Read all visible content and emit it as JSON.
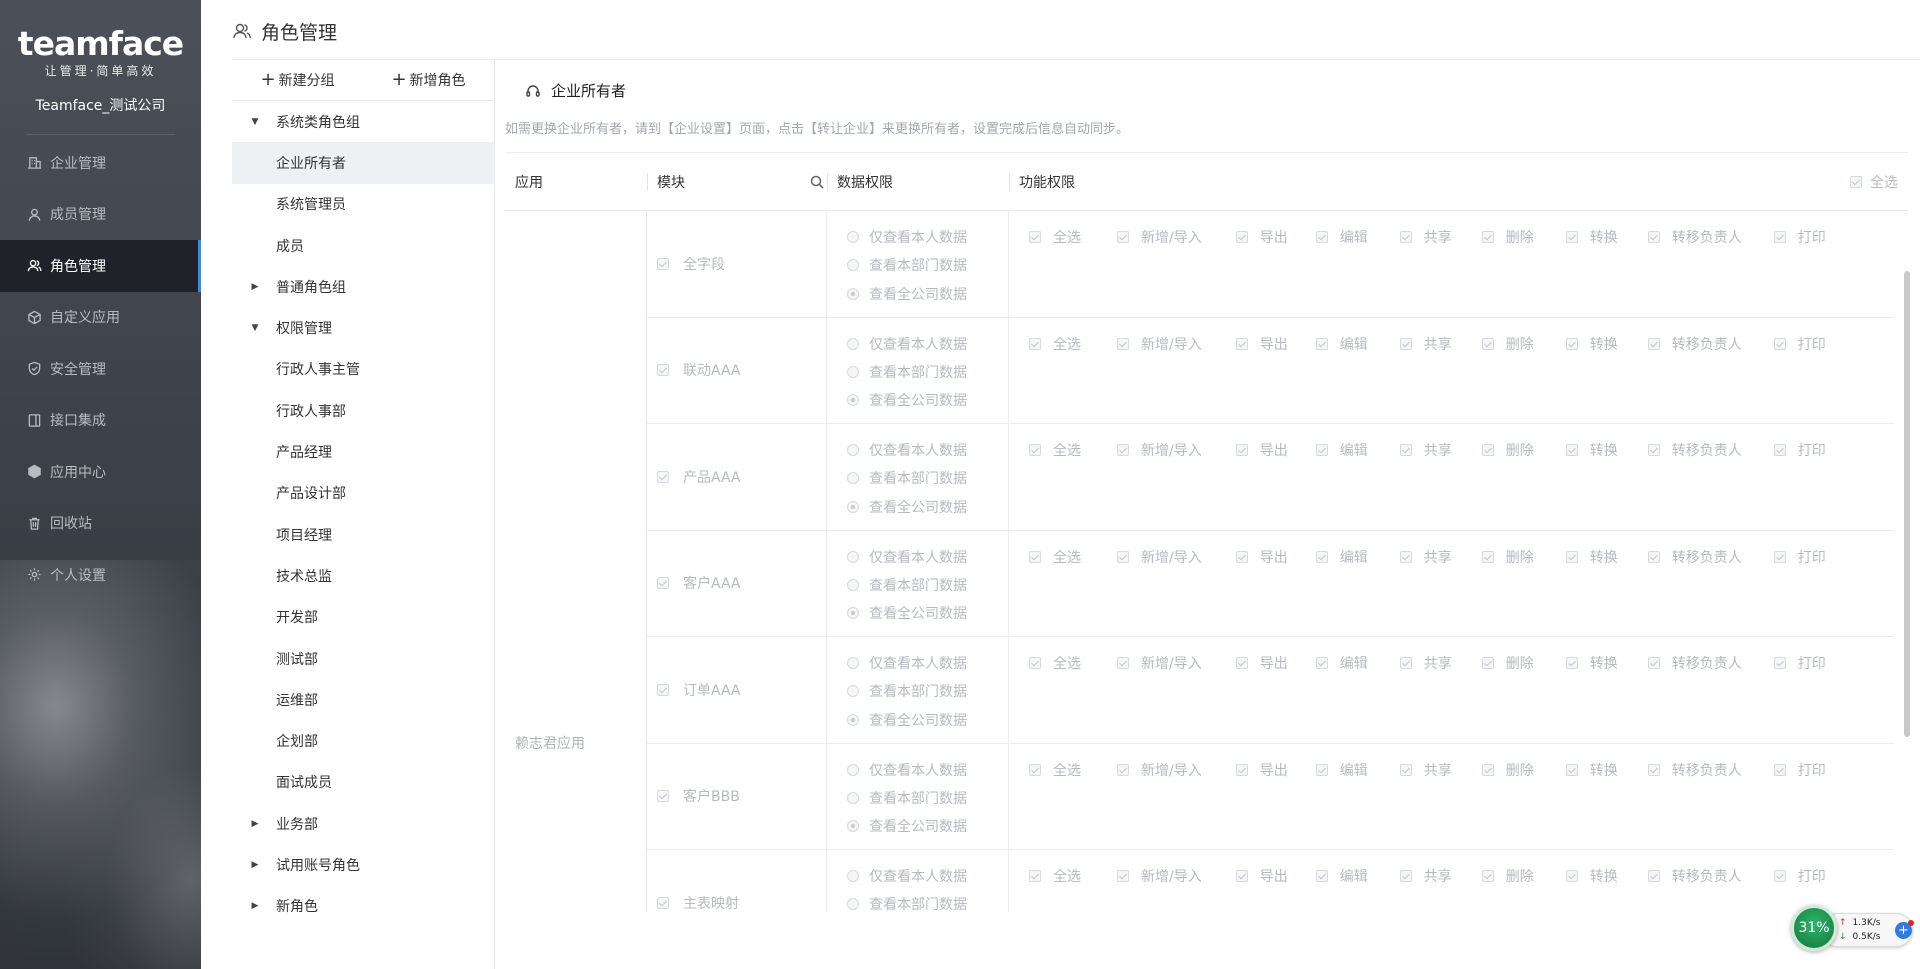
{
  "sidebar": {
    "logo": "teamface",
    "tagline": "让管理·简单高效",
    "company": "Teamface_测试公司",
    "items": [
      {
        "label": "企业管理",
        "icon": "building-icon"
      },
      {
        "label": "成员管理",
        "icon": "user-icon"
      },
      {
        "label": "角色管理",
        "icon": "users-icon",
        "active": true
      },
      {
        "label": "自定义应用",
        "icon": "cube-icon"
      },
      {
        "label": "安全管理",
        "icon": "shield-icon"
      },
      {
        "label": "接口集成",
        "icon": "plug-icon"
      },
      {
        "label": "应用中心",
        "icon": "box-icon"
      },
      {
        "label": "回收站",
        "icon": "trash-icon"
      },
      {
        "label": "个人设置",
        "icon": "gear-icon"
      }
    ]
  },
  "header": {
    "title": "角色管理",
    "icon": "users-icon"
  },
  "role_panel": {
    "new_group": "新建分组",
    "new_role": "新增角色",
    "tree": [
      {
        "label": "系统类角色组",
        "type": "group",
        "expanded": true
      },
      {
        "label": "企业所有者",
        "type": "child",
        "selected": true
      },
      {
        "label": "系统管理员",
        "type": "child"
      },
      {
        "label": "成员",
        "type": "child"
      },
      {
        "label": "普通角色组",
        "type": "group",
        "expanded": false
      },
      {
        "label": "权限管理",
        "type": "group",
        "expanded": true
      },
      {
        "label": "行政人事主管",
        "type": "child"
      },
      {
        "label": "行政人事部",
        "type": "child"
      },
      {
        "label": "产品经理",
        "type": "child"
      },
      {
        "label": "产品设计部",
        "type": "child"
      },
      {
        "label": "项目经理",
        "type": "child"
      },
      {
        "label": "技术总监",
        "type": "child"
      },
      {
        "label": "开发部",
        "type": "child"
      },
      {
        "label": "测试部",
        "type": "child"
      },
      {
        "label": "运维部",
        "type": "child"
      },
      {
        "label": "企划部",
        "type": "child"
      },
      {
        "label": "面试成员",
        "type": "child"
      },
      {
        "label": "业务部",
        "type": "group",
        "expanded": false
      },
      {
        "label": "试用账号角色",
        "type": "group",
        "expanded": false
      },
      {
        "label": "新角色",
        "type": "group",
        "expanded": false
      }
    ]
  },
  "content": {
    "title": "企业所有者",
    "title_icon": "headset-icon",
    "hint": "如需更换企业所有者，请到【企业设置】页面，点击【转让企业】来更换所有者，设置完成后信息自动同步。",
    "columns": {
      "app": "应用",
      "module": "模块",
      "data_perm": "数据权限",
      "func_perm": "功能权限",
      "select_all": "全选"
    },
    "app_name": "赖志君应用",
    "data_options": [
      "仅查看本人数据",
      "查看本部门数据",
      "查看全公司数据"
    ],
    "func_options": [
      "全选",
      "新增/导入",
      "导出",
      "编辑",
      "共享",
      "删除",
      "转换",
      "转移负责人",
      "打印"
    ],
    "modules": [
      {
        "name": "全字段",
        "selected_data": 2
      },
      {
        "name": "联动AAA",
        "selected_data": 2
      },
      {
        "name": "产品AAA",
        "selected_data": 2
      },
      {
        "name": "客户AAA",
        "selected_data": 2
      },
      {
        "name": "订单AAA",
        "selected_data": 2
      },
      {
        "name": "客户BBB",
        "selected_data": 2
      },
      {
        "name": "主表映射",
        "selected_data": 2
      }
    ]
  },
  "net_widget": {
    "percent": "31%",
    "up": "1.3K/s",
    "down": "0.5K/s"
  }
}
